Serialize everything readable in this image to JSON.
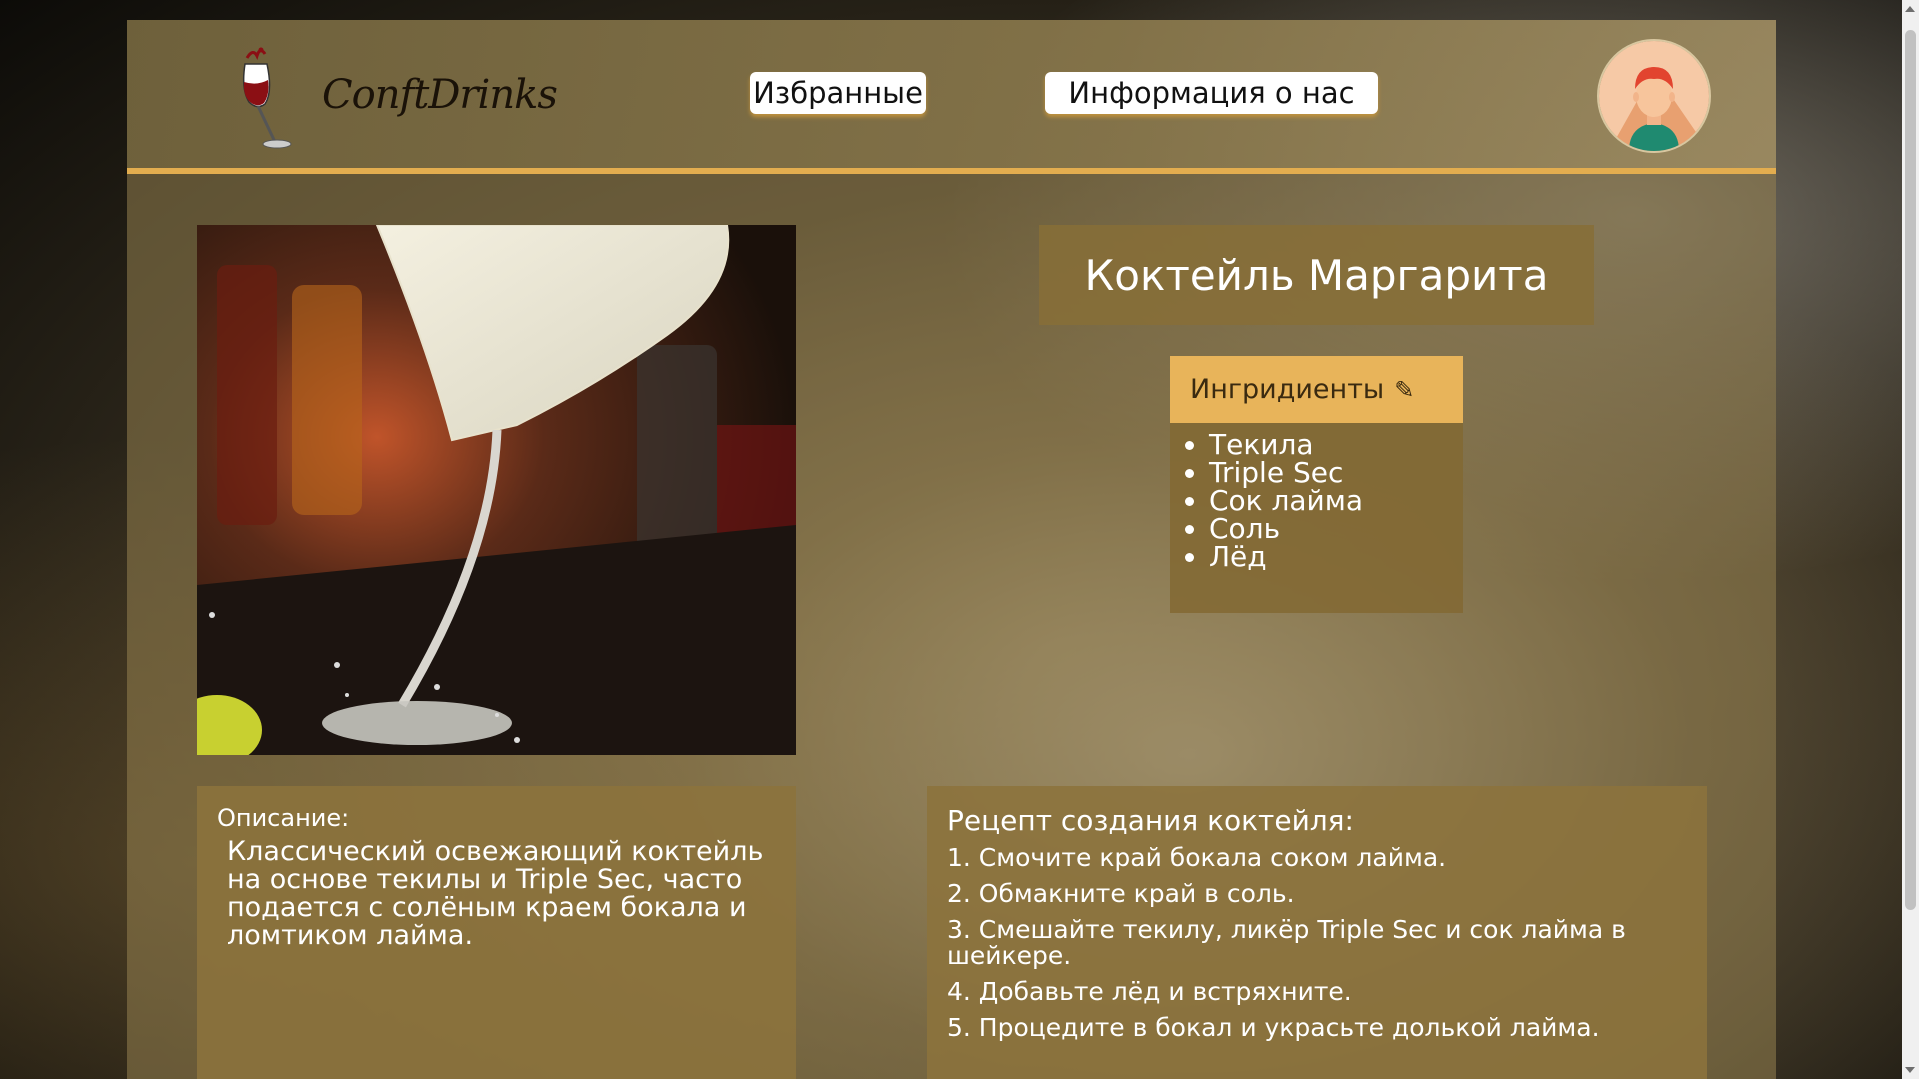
{
  "header": {
    "logo_text": "ConftDrinks",
    "nav": [
      {
        "label": "Избранные"
      },
      {
        "label": "Информация о нас"
      }
    ],
    "avatar_icon": "user-avatar-icon"
  },
  "cocktail": {
    "title": "Коктейль Маргарита",
    "ingredients_heading": "Ингридиенты",
    "ingredients_icon": "pencil-icon",
    "ingredients": [
      "Текила",
      "Triple Sec",
      "Сок лайма",
      "Соль",
      "Лёд"
    ],
    "description_label": "Описание:",
    "description": "Классический освежающий коктейль на основе текилы и Triple Sec, часто подается с солёным краем бокала и ломтиком лайма.",
    "recipe_title": "Рецепт создания коктейля:",
    "recipe_steps": [
      "1. Смочите край бокала соком лайма.",
      "2. Обмакните край в соль.",
      "3. Смешайте текилу, ликёр Triple Sec и сок лайма в шейкере.",
      "4. Добавьте лёд и встряхните.",
      "5. Процедите в бокал и украсьте долькой лайма."
    ]
  },
  "colors": {
    "accent": "#e3ad4f",
    "panel": "#8c733c"
  }
}
